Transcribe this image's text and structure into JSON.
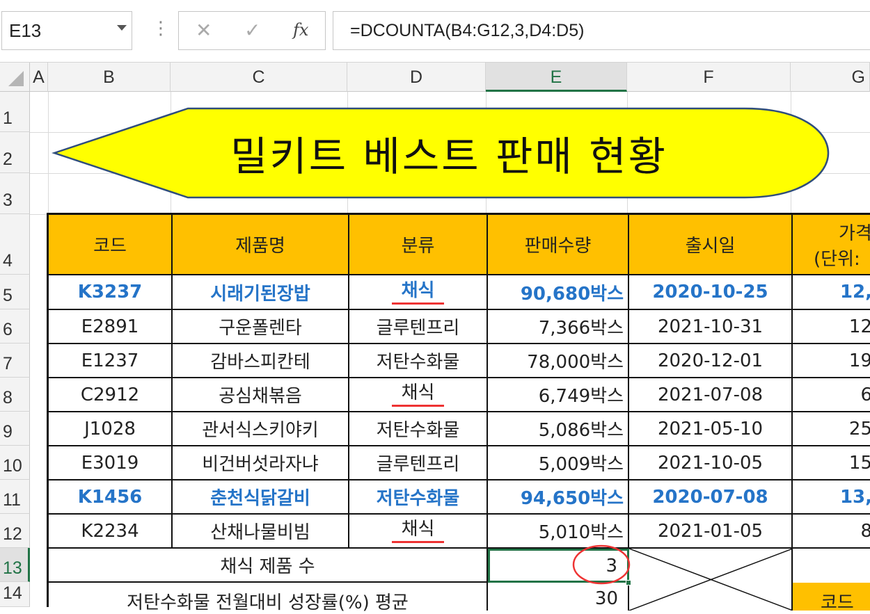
{
  "formula_bar": {
    "name_box": "E13",
    "cancel_icon": "✕",
    "enter_icon": "✓",
    "fx_label": "fx",
    "formula": "=DCOUNTA(B4:G12,3,D4:D5)"
  },
  "columns": [
    "A",
    "B",
    "C",
    "D",
    "E",
    "F",
    "G"
  ],
  "rows": [
    "1",
    "2",
    "3",
    "4",
    "5",
    "6",
    "7",
    "8",
    "9",
    "10",
    "11",
    "12",
    "13",
    "14"
  ],
  "banner": {
    "title": "밀키트 베스트 판매 현황",
    "fill": "#ffff00"
  },
  "table": {
    "headers": [
      "코드",
      "제품명",
      "분류",
      "판매수량",
      "출시일"
    ],
    "header_g_line1": "가격",
    "header_g_line2": "(단위:",
    "data": [
      {
        "code": "K3237",
        "name": "시래기된장밥",
        "cat": "채식",
        "qty": "90,680박스",
        "date": "2020-10-25",
        "price": "12,"
      },
      {
        "code": "E2891",
        "name": "구운폴렌타",
        "cat": "글루텐프리",
        "qty": "7,366박스",
        "date": "2021-10-31",
        "price": "12"
      },
      {
        "code": "E1237",
        "name": "감바스피칸테",
        "cat": "저탄수화물",
        "qty": "78,000박스",
        "date": "2020-12-01",
        "price": "19"
      },
      {
        "code": "C2912",
        "name": "공심채볶음",
        "cat": "채식",
        "qty": "6,749박스",
        "date": "2021-07-08",
        "price": "6"
      },
      {
        "code": "J1028",
        "name": "관서식스키야키",
        "cat": "저탄수화물",
        "qty": "5,086박스",
        "date": "2021-05-10",
        "price": "25"
      },
      {
        "code": "E3019",
        "name": "비건버섯라자냐",
        "cat": "글루텐프리",
        "qty": "5,009박스",
        "date": "2021-10-05",
        "price": "15"
      },
      {
        "code": "K1456",
        "name": "춘천식닭갈비",
        "cat": "저탄수화물",
        "qty": "94,650박스",
        "date": "2020-07-08",
        "price": "13,"
      },
      {
        "code": "K2234",
        "name": "산채나물비빔",
        "cat": "채식",
        "qty": "5,010박스",
        "date": "2021-01-05",
        "price": "8"
      }
    ],
    "summary1_label": "채식 제품 수",
    "summary1_value": "3",
    "summary2_label": "저탄수화물 전월대비 성장률(%) 평균",
    "summary2_value": "30",
    "g14_label": "코드"
  },
  "colors": {
    "header_fill": "#ffc000",
    "highlight_text": "#2574c8",
    "underline": "#e33333",
    "selection": "#217346"
  }
}
